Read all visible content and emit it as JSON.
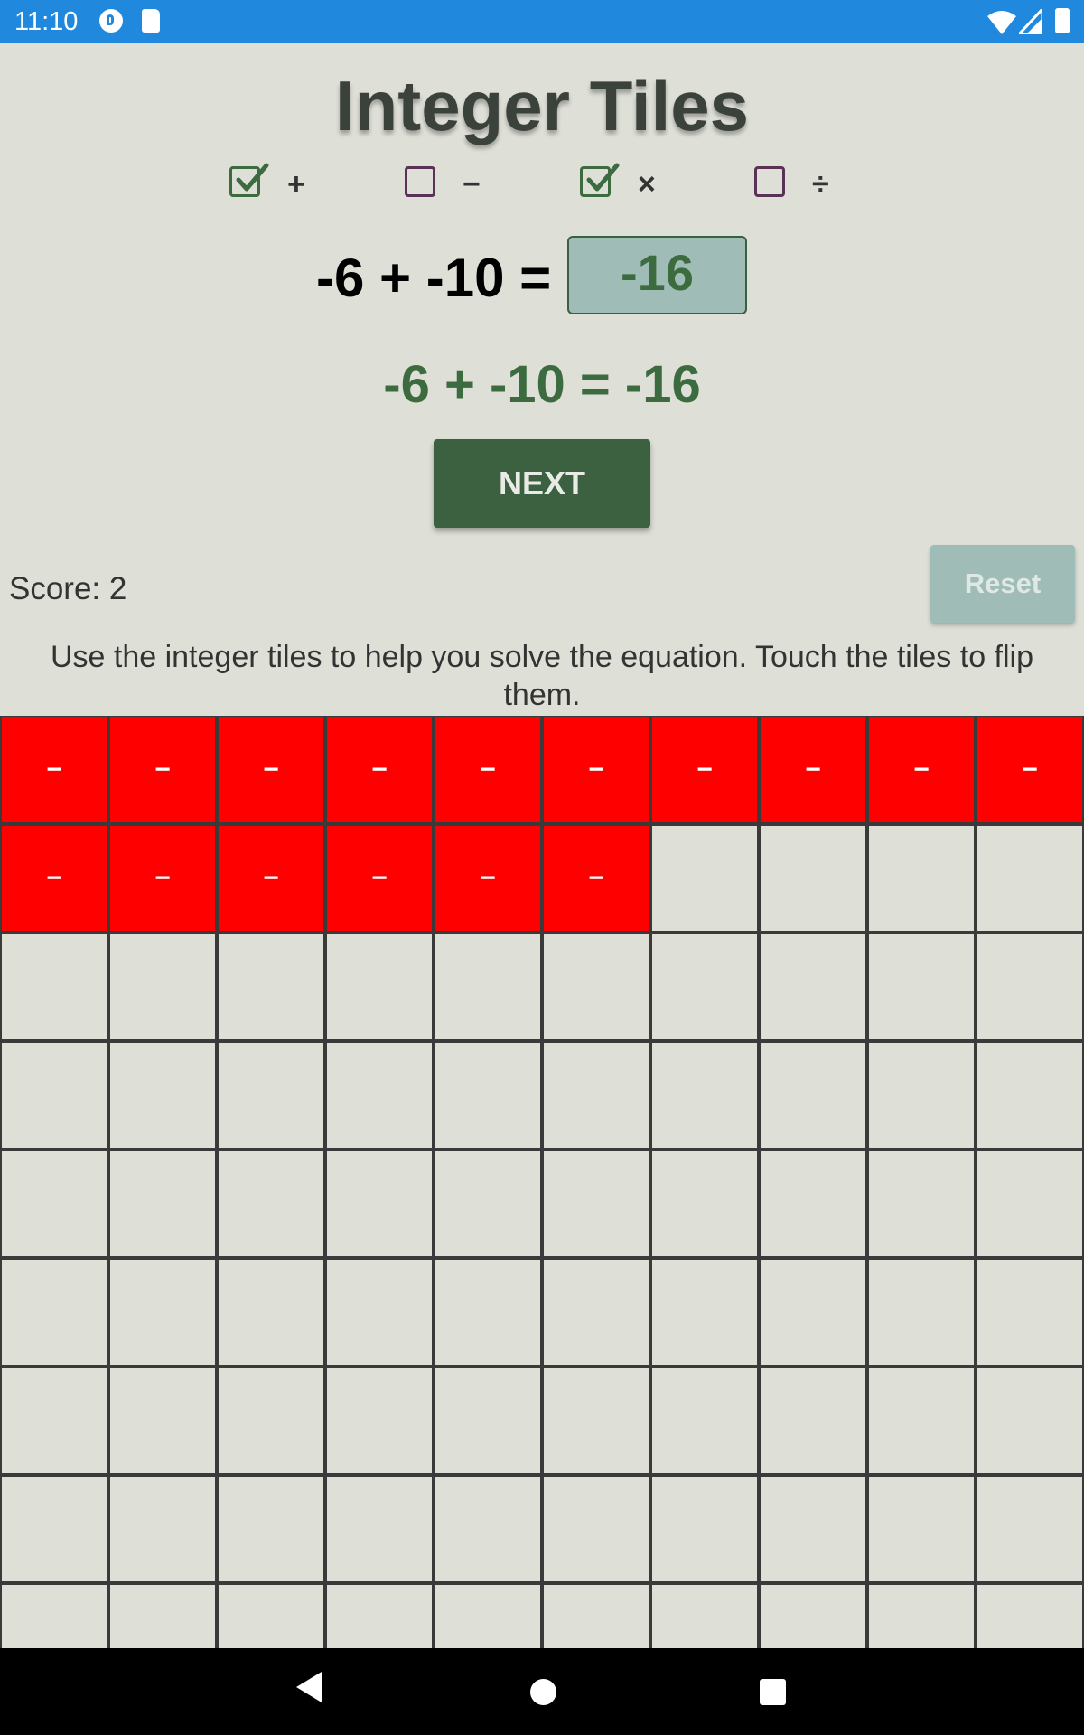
{
  "status_bar": {
    "time": "11:10",
    "icons": [
      "app-p-icon",
      "sd-card-icon",
      "wifi-icon",
      "signal-icon",
      "battery-icon"
    ]
  },
  "title": "Integer Tiles",
  "operations": [
    {
      "symbol": "+",
      "checked": true
    },
    {
      "symbol": "−",
      "checked": false
    },
    {
      "symbol": "×",
      "checked": true
    },
    {
      "symbol": "÷",
      "checked": false
    }
  ],
  "equation": {
    "prompt": "-6 + -10 =",
    "answer": "-16"
  },
  "feedback": "-6 + -10 = -16",
  "next_label": "NEXT",
  "score_text": "Score: 2",
  "reset_label": "Reset",
  "instructions": "Use the integer tiles to help you solve the equation. Touch the tiles to flip them.",
  "tiles": {
    "columns": 10,
    "rows_visible": 9,
    "negative_count": 16,
    "negative_symbol": "−",
    "colors": {
      "negative": "#ff0000",
      "empty": "#dedfd7",
      "border": "#3a3a3a"
    }
  },
  "nav_bar": {
    "icons": [
      "back-icon",
      "home-icon",
      "recents-icon"
    ]
  }
}
